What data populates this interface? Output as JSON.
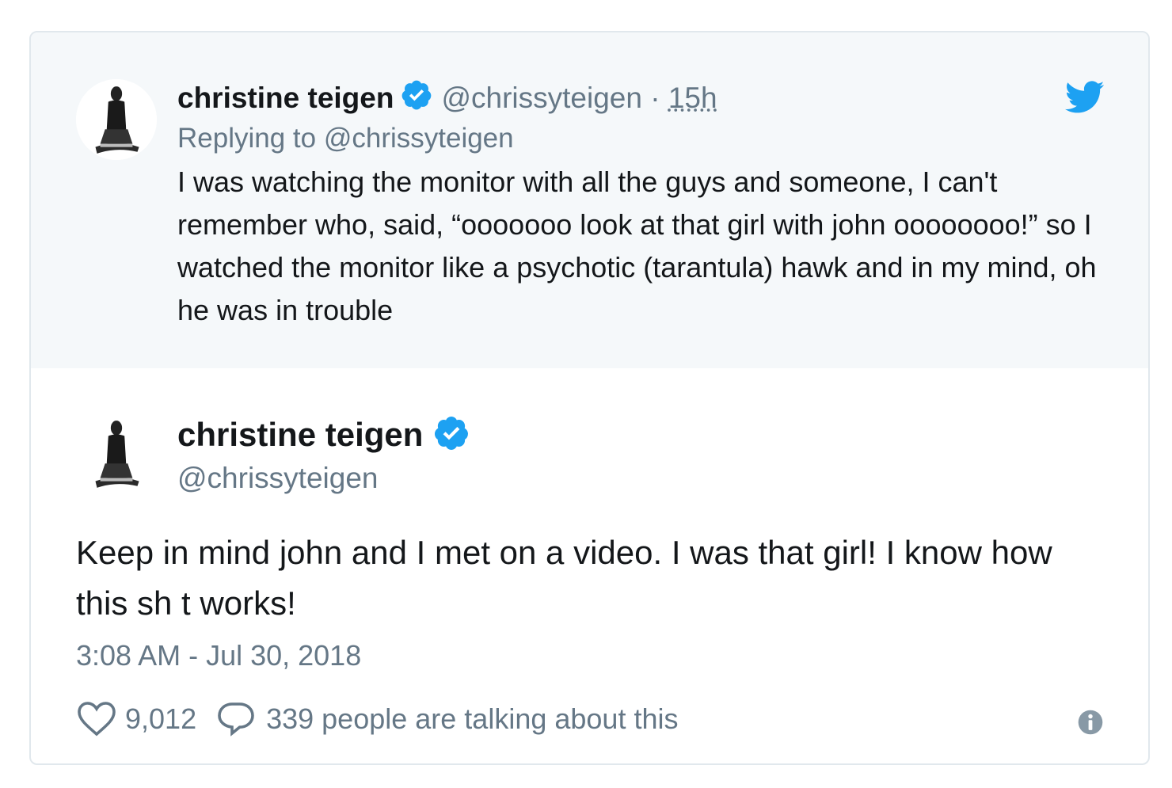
{
  "parent_tweet": {
    "name": "christine teigen",
    "handle": "@chrissyteigen",
    "separator": "·",
    "time": "15h",
    "replying_prefix": "Replying to ",
    "replying_to": "@chrissyteigen",
    "text": "I was watching the monitor with all the guys and someone, I can't remember who, said, “ooooooo look at that girl with john oooooooo!” so I watched the monitor like a psychotic (tarantula) hawk and in my mind, oh he was in trouble",
    "avatar_icon": "profile-photo",
    "brand_icon": "twitter-bird-icon"
  },
  "main_tweet": {
    "name": "christine teigen",
    "handle": "@chrissyteigen",
    "text": "Keep in mind john and I met on a video. I was that girl! I know how this sh t works!",
    "timestamp": "3:08 AM - Jul 30, 2018",
    "like_count": "9,012",
    "talking_text": "339 people are talking about this",
    "avatar_icon": "profile-photo"
  },
  "colors": {
    "twitter_blue": "#1da1f2",
    "verified_blue": "#1da1f2",
    "secondary_text": "#657786",
    "parent_background": "#f5f8fa",
    "border": "#e1e8ed"
  }
}
